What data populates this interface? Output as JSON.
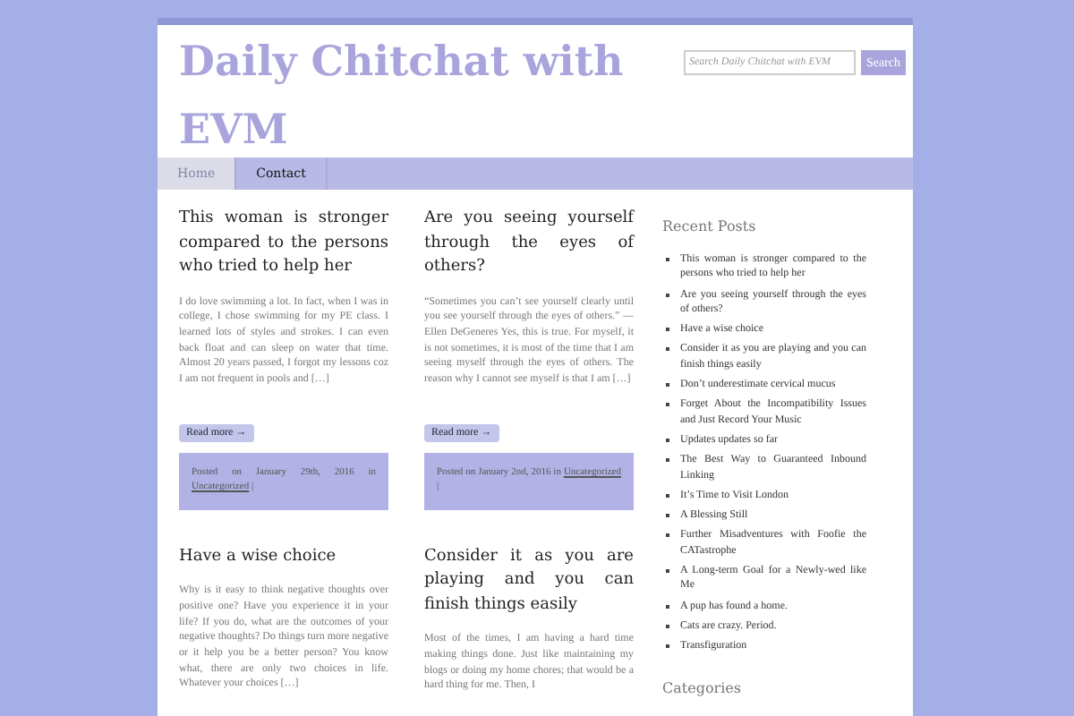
{
  "site_title": "Daily Chitchat with EVM",
  "search": {
    "placeholder": "Search Daily Chitchat with EVM",
    "button": "Search"
  },
  "nav": [
    {
      "label": "Home",
      "selected": true
    },
    {
      "label": "Contact",
      "selected": false
    }
  ],
  "posts": [
    {
      "title": "This woman is stronger compared to the persons who tried to help her",
      "excerpt": "I do love swimming a lot. In fact, when I was in college, I chose swimming for my PE class. I learned lots of styles and strokes. I can even back float and can sleep on water that time. Almost 20 years passed, I forgot my lessons coz I am not frequent in pools and […]",
      "read_more": "Read more →",
      "meta": "Posted on January 29th, 2016 in",
      "category": "Uncategorized",
      "separator": "|"
    },
    {
      "title": "Are you seeing yourself through the eyes of others?",
      "excerpt": "“Sometimes you can’t see yourself clearly until you see yourself through the eyes of others.” ― Ellen DeGeneres Yes, this is true. For myself, it is not sometimes, it is most of the time that I am seeing myself through the eyes of others. The reason why I cannot see myself is that I am […]",
      "read_more": "Read more →",
      "meta": "Posted on January 2nd, 2016 in",
      "category": "Uncategorized",
      "separator": "|"
    },
    {
      "title": "Have a wise choice",
      "excerpt": "Why is it easy to think negative thoughts over positive one? Have you experience it in your life? If you do, what are the outcomes of your negative thoughts? Do things turn more negative or it help you be a better person? You know what, there are only two choices in life. Whatever your choices […]"
    },
    {
      "title": "Consider it as you are playing and you can finish things easily",
      "excerpt": "Most of the times, I am having a hard time making things done. Just like maintaining my blogs or doing my home chores; that would be a hard thing for me. Then, I"
    }
  ],
  "sidebar": {
    "recent_posts_title": "Recent Posts",
    "recent_posts": [
      "This woman is stronger compared to the persons who tried to help her",
      "Are you seeing yourself through the eyes of others?",
      "Have a wise choice",
      "Consider it as you are playing and you can finish things easily",
      "Don’t underestimate cervical mucus",
      "Forget About the Incompatibility Issues and Just Record Your Music",
      "Updates updates so far",
      "The Best Way to Guaranteed Inbound Linking",
      "It’s Time to Visit London",
      "A Blessing Still",
      "Further Misadventures with Foofie the CATastrophe",
      "A Long-term Goal for a Newly-wed like Me",
      "A pup has found a home.",
      "Cats are crazy. Period.",
      "Transfiguration"
    ],
    "categories_title": "Categories"
  }
}
